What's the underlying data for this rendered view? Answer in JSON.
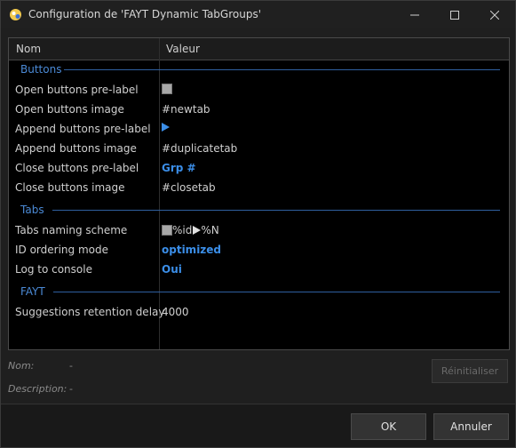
{
  "window": {
    "title": "Configuration de 'FAYT Dynamic TabGroups'"
  },
  "grid": {
    "headers": {
      "name": "Nom",
      "value": "Valeur"
    },
    "sections": [
      {
        "label": "Buttons"
      },
      {
        "label": "Tabs"
      },
      {
        "label": "FAYT"
      }
    ],
    "rows": [
      {
        "name": "Open buttons pre-label",
        "value": ""
      },
      {
        "name": "Open buttons image",
        "value": "#newtab"
      },
      {
        "name": "Append buttons pre-label",
        "value": ""
      },
      {
        "name": "Append buttons image",
        "value": "#duplicatetab"
      },
      {
        "name": "Close buttons pre-label",
        "value": "Grp #"
      },
      {
        "name": "Close buttons image",
        "value": "#closetab"
      },
      {
        "name": "Tabs naming scheme",
        "value_part1": "%id",
        "value_part2": " %N"
      },
      {
        "name": "ID ordering mode",
        "value": "optimized"
      },
      {
        "name": "Log to console",
        "value": "Oui"
      },
      {
        "name": "Suggestions retention delay",
        "value": "4000"
      }
    ]
  },
  "info": {
    "name_label": "Nom:",
    "name_value": "-",
    "description_label": "Description:",
    "description_value": "-"
  },
  "buttons": {
    "reset": "Réinitialiser",
    "ok": "OK",
    "cancel": "Annuler"
  },
  "colors": {
    "accent": "#3b8ee8",
    "section": "#4b8ad6",
    "background": "#000000"
  }
}
